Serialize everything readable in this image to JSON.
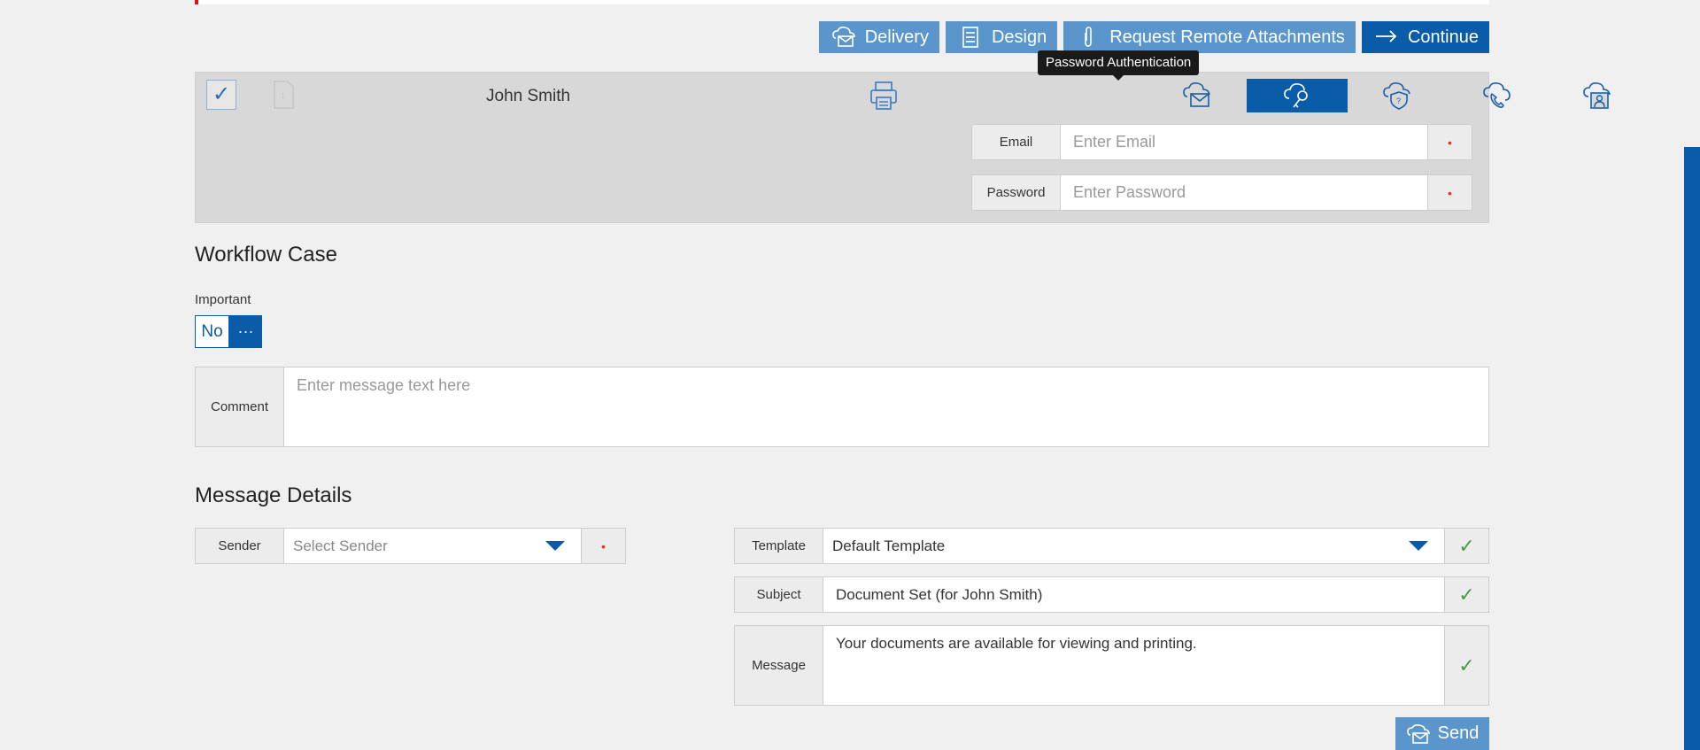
{
  "colors": {
    "accent": "#0a5ca8",
    "button_light": "#5a96cc",
    "panel": "#d8d8d8",
    "background": "#f0f0f0"
  },
  "toolbar": {
    "delivery_label": "Delivery",
    "design_label": "Design",
    "request_label": "Request Remote Attachments",
    "continue_label": "Continue"
  },
  "tooltip": {
    "text": "Password Authentication"
  },
  "recipient": {
    "name": "John Smith",
    "auth_methods": [
      "envelope-cloud-icon",
      "key-cloud-icon",
      "shield-question-icon",
      "phone-cloud-icon",
      "person-id-icon"
    ],
    "selected_auth": "Password Authentication",
    "email": {
      "label": "Email",
      "placeholder": "Enter Email",
      "required_mark": "•"
    },
    "password": {
      "label": "Password",
      "placeholder": "Enter Password",
      "required_mark": "•"
    }
  },
  "workflow": {
    "title": "Workflow Case",
    "important_label": "Important",
    "important_value": "No",
    "more_label": "···",
    "comment_label": "Comment",
    "comment_placeholder": "Enter message text here"
  },
  "message": {
    "title": "Message Details",
    "sender_label": "Sender",
    "sender_placeholder": "Select Sender",
    "sender_required": "•",
    "template_label": "Template",
    "template_value": "Default Template",
    "subject_label": "Subject",
    "subject_value": "Document Set (for John Smith)",
    "message_label": "Message",
    "message_value": "Your documents are available for viewing and printing.",
    "check_mark": "✓",
    "send_label": "Send"
  }
}
